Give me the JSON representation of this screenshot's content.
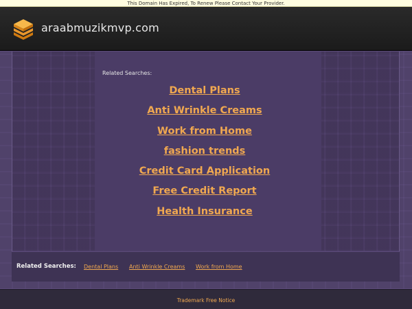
{
  "notice": "This Domain Has Expired, To Renew Please Contact Your Provider.",
  "header": {
    "site_name": "araabmuzikmvp.com",
    "logo_icon": "stacked-layers-icon",
    "logo_colors": [
      "#f5a623",
      "#e07b00"
    ]
  },
  "main": {
    "related_label": "Related Searches:",
    "links": [
      "Dental Plans",
      "Anti Wrinkle Creams",
      "Work from Home",
      "fashion trends",
      "Credit Card Application",
      "Free Credit Report",
      "Health Insurance"
    ]
  },
  "footer": {
    "related_label": "Related Searches:",
    "links": [
      "Dental Plans",
      "Anti Wrinkle Creams",
      "Work from Home"
    ],
    "trademark": "Trademark Free Notice"
  },
  "colors": {
    "link": "#f0a850",
    "background": "#5a4a78",
    "header": "#1f1f1f"
  }
}
